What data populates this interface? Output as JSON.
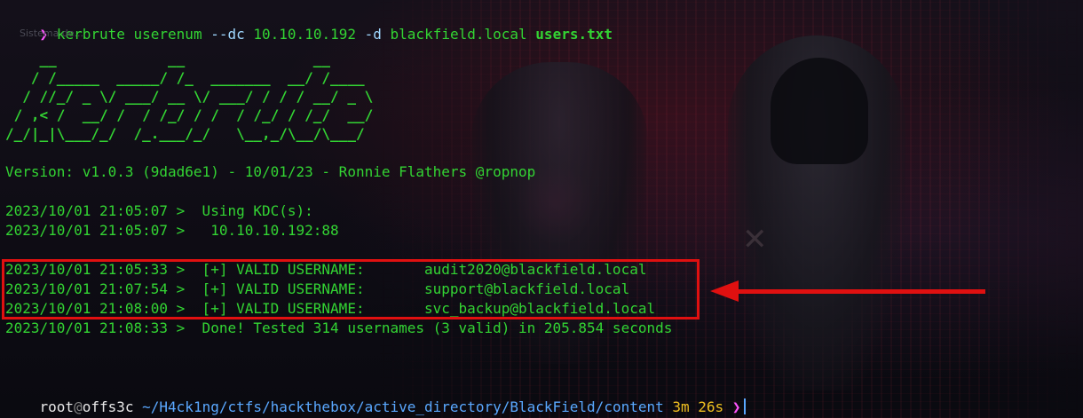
{
  "terminal": {
    "command": {
      "prompt_symbol": "❯",
      "tool": "kerbrute userenum",
      "flag_dc": "--dc",
      "dc_value": "10.10.10.192",
      "flag_d": "-d",
      "domain": "blackfield.local",
      "users_file": "users.txt"
    },
    "hint_text": "Sistema de...",
    "banner_lines": [
      "    __             __               __     ",
      "   / /_____  _____/ /_  _______  __/ /____ ",
      "  / //_/ _ \\/ ___/ __ \\/ ___/ / / / __/ _ \\",
      " / ,< /  __/ /  / /_/ / /  / /_/ / /_/  __/",
      "/_/|_|\\___/_/  /_.___/_/   \\__,_/\\__/\\___/ "
    ],
    "version_line": "Version: v1.0.3 (9dad6e1) - 10/01/23 - Ronnie Flathers @ropnop",
    "kdc_lines": [
      "2023/10/01 21:05:07 >  Using KDC(s):",
      "2023/10/01 21:05:07 >   10.10.10.192:88"
    ],
    "valid_lines": [
      "2023/10/01 21:05:33 >  [+] VALID USERNAME:       audit2020@blackfield.local",
      "2023/10/01 21:07:54 >  [+] VALID USERNAME:       support@blackfield.local",
      "2023/10/01 21:08:00 >  [+] VALID USERNAME:       svc_backup@blackfield.local"
    ],
    "done_line": "2023/10/01 21:08:33 >  Done! Tested 314 usernames (3 valid) in 205.854 seconds",
    "final_prompt": {
      "user": "root",
      "at": "@",
      "host": "offs3c",
      "path": "~/H4ck1ng/ctfs/hackthebox/active_directory/BlackField/content",
      "duration": "3m 26s",
      "arrow": "❯"
    }
  },
  "annotation": {
    "box_color": "#e01010",
    "arrow_color": "#e01010"
  }
}
